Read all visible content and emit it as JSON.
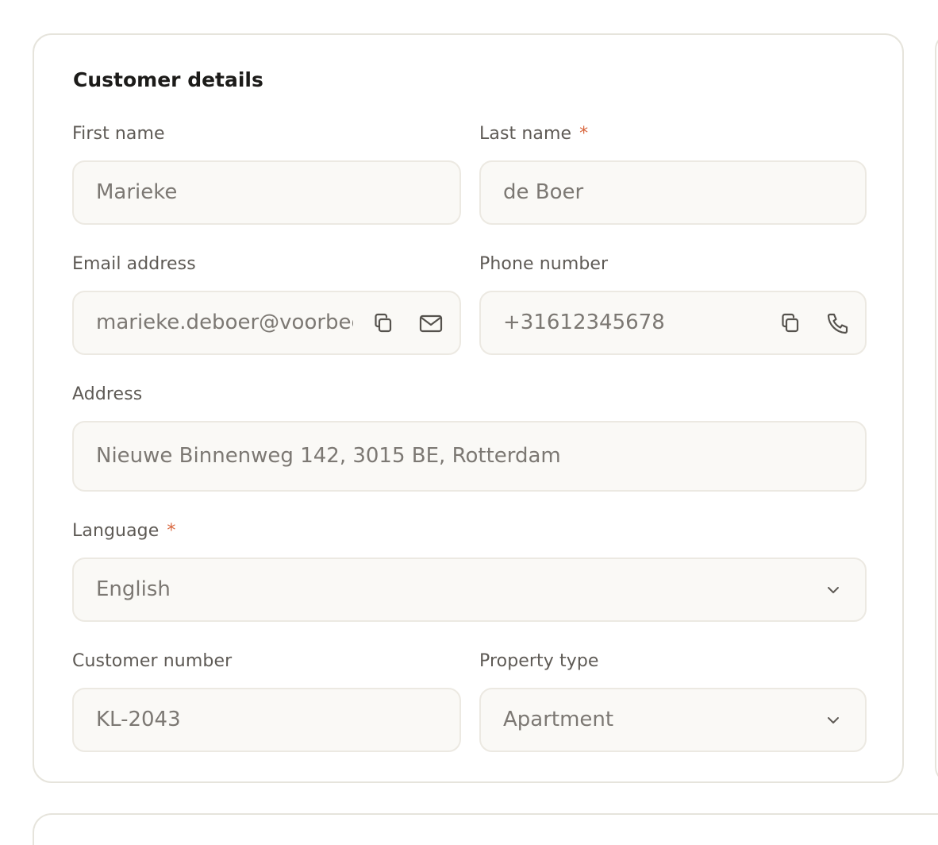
{
  "section": {
    "title": "Customer details"
  },
  "fields": {
    "first_name": {
      "label": "First name",
      "value": "Marieke"
    },
    "last_name": {
      "label": "Last name",
      "required_mark": "*",
      "value": "de Boer"
    },
    "email": {
      "label": "Email address",
      "value": "marieke.deboer@voorbeeld.nl",
      "icons": [
        "copy-icon",
        "mail-icon"
      ]
    },
    "phone": {
      "label": "Phone number",
      "value": "+31612345678",
      "icons": [
        "copy-icon",
        "phone-icon"
      ]
    },
    "address": {
      "label": "Address",
      "value": "Nieuwe Binnenweg 142, 3015 BE, Rotterdam"
    },
    "language": {
      "label": "Language",
      "required_mark": "*",
      "value": "English",
      "icon": "chevron-down-icon"
    },
    "customer_number": {
      "label": "Customer number",
      "value": "KL-2043"
    },
    "property_type": {
      "label": "Property type",
      "value": "Apartment",
      "icon": "chevron-down-icon"
    }
  },
  "colors": {
    "required": "#d9673f",
    "field_bg": "#faf9f6",
    "border": "#e6e4dc"
  }
}
